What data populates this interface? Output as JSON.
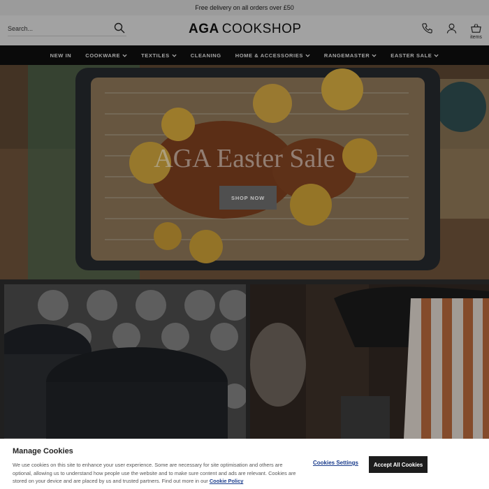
{
  "promo": {
    "text": "Free delivery on all orders over £50"
  },
  "header": {
    "search_placeholder": "Search...",
    "logo_bold": "AGA",
    "logo_regular": "COOKSHOP",
    "basket_label": "items",
    "icons": [
      "search-icon",
      "phone-icon",
      "account-icon",
      "basket-icon"
    ]
  },
  "nav": {
    "items": [
      {
        "label": "NEW IN",
        "dropdown": false
      },
      {
        "label": "COOKWARE",
        "dropdown": true
      },
      {
        "label": "TEXTILES",
        "dropdown": true
      },
      {
        "label": "CLEANING",
        "dropdown": false
      },
      {
        "label": "HOME & ACCESSORIES",
        "dropdown": true
      },
      {
        "label": "RANGEMASTER",
        "dropdown": true
      },
      {
        "label": "EASTER SALE",
        "dropdown": true
      }
    ]
  },
  "hero": {
    "title": "AGA Easter Sale",
    "cta": "SHOP NOW"
  },
  "cookie": {
    "title": "Manage Cookies",
    "text": "We use cookies on this site to enhance your user experience. Some are necessary for site optimisation and others are optional, allowing us to understand how people use the website and to make sure content and ads are relevant. Cookies are stored on your device and are placed by us and trusted partners. Find out more in our",
    "policy_link": "Cookie Policy",
    "settings_label": "Cookies Settings",
    "accept_label": "Accept All Cookies"
  },
  "colors": {
    "nav_bg": "#0e0e0e",
    "header_bg": "#d9d9d9",
    "accept_bg": "#1c1c1c",
    "link": "#1a3c8c"
  }
}
